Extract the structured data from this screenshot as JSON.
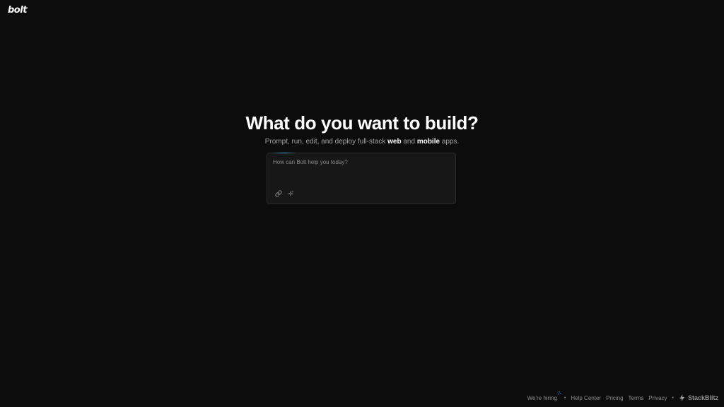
{
  "header": {
    "logo_text": "bolt"
  },
  "hero": {
    "title": "What do you want to build?",
    "subtitle_prefix": "Prompt, run, edit, and deploy full-stack",
    "subtitle_web": "web",
    "subtitle_and": "and",
    "subtitle_mobile": "mobile",
    "subtitle_suffix": "apps."
  },
  "prompt": {
    "placeholder": "How can Bolt help you today?",
    "value": "",
    "tools": [
      {
        "icon": "link-icon"
      },
      {
        "icon": "sparkle-icon"
      }
    ]
  },
  "footer": {
    "hiring": "We're hiring",
    "separator": "•",
    "links": [
      "Help Center",
      "Pricing",
      "Terms",
      "Privacy"
    ],
    "brand": "StackBlitz",
    "brand_icon": "lightning-bolt-icon"
  },
  "colors": {
    "background": "#0c0c0c",
    "prompt_bg": "#171717",
    "accent": "#38bdf8"
  }
}
